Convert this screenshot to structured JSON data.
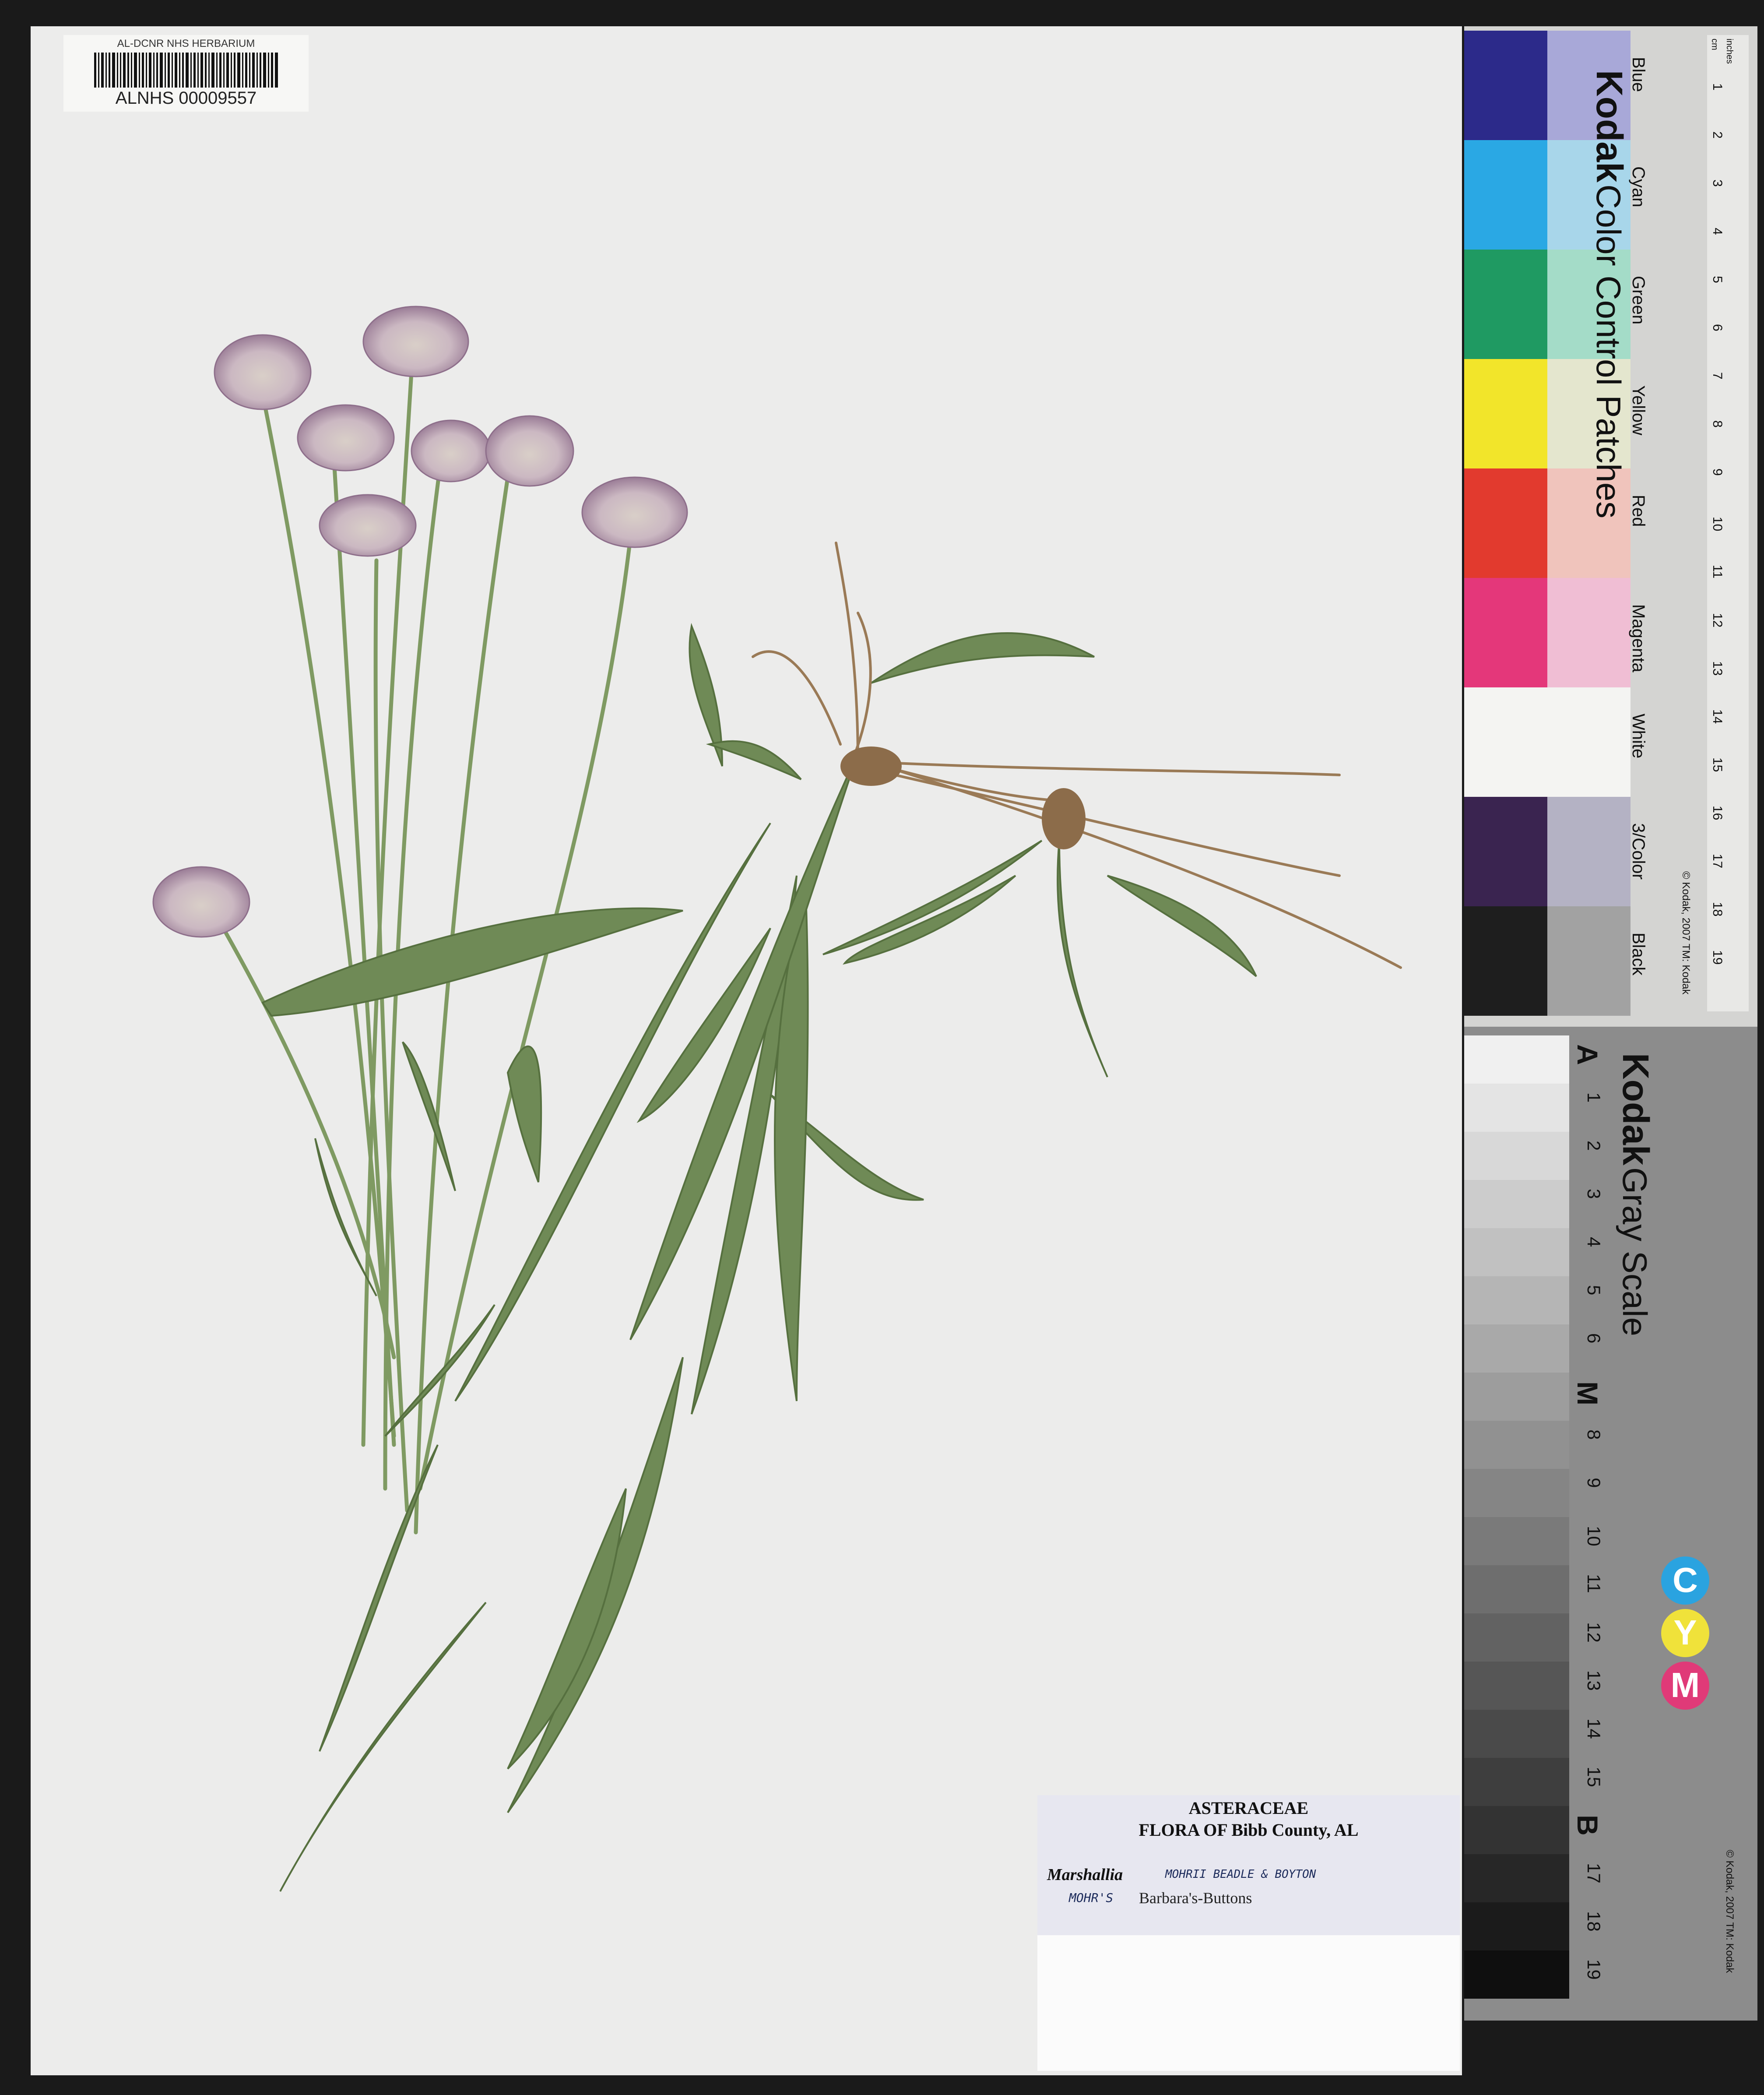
{
  "barcode": {
    "institution": "AL-DCNR NHS HERBARIUM",
    "catalog_number": "ALNHS 00009557"
  },
  "label": {
    "family": "ASTERACEAE",
    "flora": "FLORA OF Bibb County, AL",
    "genus": "Marshallia",
    "handwritten_epithet": "MOHRII BEADLE & BOYTON",
    "handwritten_prefix": "MOHR'S",
    "common_name": "Barbara's-Buttons"
  },
  "color_card": {
    "brand": "Kodak",
    "title": "Color Control Patches",
    "patch_names": [
      "Blue",
      "Cyan",
      "Green",
      "Yellow",
      "Red",
      "Magenta",
      "White",
      "3/Color",
      "Black"
    ],
    "dark_colors": [
      "#2c2a8a",
      "#2aa8e4",
      "#1f9a62",
      "#f2e52a",
      "#e23a2e",
      "#e4377a",
      "#f4f4f2",
      "#3a2450",
      "#1e1e1e"
    ],
    "light_colors": [
      "#a8a8d8",
      "#a8d6ea",
      "#a4dcc8",
      "#e4e6ce",
      "#f0c4bc",
      "#f0bed4",
      "#f4f4f2",
      "#b4b2c4",
      "#a2a2a2"
    ],
    "ruler_units": [
      "inches",
      "cm"
    ],
    "ruler_numbers": [
      "1",
      "2",
      "3",
      "4",
      "5",
      "6",
      "7",
      "8",
      "9",
      "10",
      "11",
      "12",
      "13",
      "14",
      "15",
      "16",
      "17",
      "18",
      "19"
    ],
    "copyright": "© Kodak, 2007 TM: Kodak"
  },
  "gray_card": {
    "brand": "Kodak",
    "title": "Gray Scale",
    "labels": [
      "A",
      "1",
      "2",
      "3",
      "4",
      "5",
      "6",
      "M",
      "8",
      "9",
      "10",
      "11",
      "12",
      "13",
      "14",
      "15",
      "B",
      "17",
      "18",
      "19"
    ],
    "cym": [
      {
        "letter": "C",
        "color": "#2aa3e0"
      },
      {
        "letter": "Y",
        "color": "#f0e23a"
      },
      {
        "letter": "M",
        "color": "#e03a78"
      }
    ],
    "copyright": "© Kodak, 2007 TM: Kodak"
  }
}
